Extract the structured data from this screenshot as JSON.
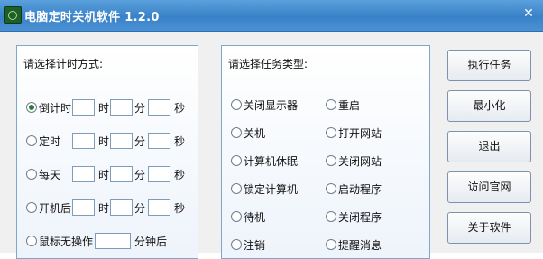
{
  "window": {
    "title": "电脑定时关机软件 1.2.0",
    "close_glyph": "✕"
  },
  "timing": {
    "heading": "请选择计时方式:",
    "options": [
      {
        "label": "倒计时",
        "checked": true,
        "units": [
          "时",
          "分",
          "秒"
        ]
      },
      {
        "label": "定时",
        "checked": false,
        "units": [
          "时",
          "分",
          "秒"
        ]
      },
      {
        "label": "每天",
        "checked": false,
        "units": [
          "时",
          "分",
          "秒"
        ]
      },
      {
        "label": "开机后",
        "checked": false,
        "units": [
          "时",
          "分",
          "秒"
        ]
      },
      {
        "label": "鼠标无操作",
        "checked": false,
        "unit": "分钟后"
      }
    ]
  },
  "tasks": {
    "heading": "请选择任务类型:",
    "left": [
      "关闭显示器",
      "关机",
      "计算机休眠",
      "锁定计算机",
      "待机",
      "注销"
    ],
    "right": [
      "重启",
      "打开网站",
      "关闭网站",
      "启动程序",
      "关闭程序",
      "提醒消息"
    ]
  },
  "buttons": [
    "执行任务",
    "最小化",
    "退出",
    "访问官网",
    "关于软件"
  ]
}
